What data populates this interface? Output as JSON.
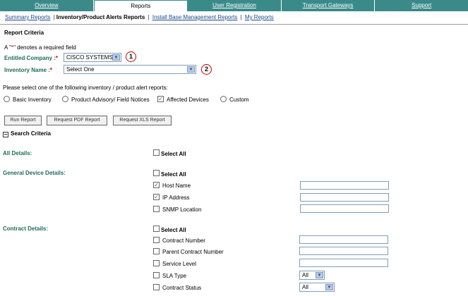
{
  "topnav": [
    {
      "label": "Overview",
      "active": false
    },
    {
      "label": "Reports",
      "active": true
    },
    {
      "label": "User Registration",
      "active": false
    },
    {
      "label": "Transport Gateways",
      "active": false
    },
    {
      "label": "Support",
      "active": false
    }
  ],
  "subnav": {
    "summary": "Summary Reports",
    "current": "Inventory/Product Alerts Reports",
    "install_base": "Install Base Management Reports",
    "my_reports": "My Reports"
  },
  "criteria": {
    "title": "Report Criteria",
    "required_note_prefix": "A \"",
    "required_star": "*",
    "required_note_suffix": "\" denotes a required field",
    "entitled_company_label": "Entitled Company :",
    "entitled_company_value": "CISCO SYSTEMS",
    "inventory_name_label": "Inventory Name :",
    "inventory_name_value": "Select One",
    "callout_1": "1",
    "callout_2": "2",
    "report_prompt": "Please select one of the following inventory / product alert reports:",
    "report_types": [
      "Basic Inventory",
      "Product Advisory/ Field Notices",
      "Affected Devices",
      "Custom"
    ]
  },
  "buttons": {
    "run": "Run Report",
    "pdf": "Request PDF Report",
    "xls": "Request XLS Report"
  },
  "search": {
    "title": "Search Criteria",
    "select_all": "Select All",
    "all_details": "All Details:",
    "general_details": "General Device Details:",
    "contract_details": "Contract Details:",
    "general_fields": [
      {
        "label": "Host Name",
        "checked": true
      },
      {
        "label": "IP Address",
        "checked": true
      },
      {
        "label": "SNMP Location",
        "checked": false
      }
    ],
    "contract_fields": [
      {
        "label": "Contract Number"
      },
      {
        "label": "Parent Contract Number"
      },
      {
        "label": "Service Level"
      },
      {
        "label": "SLA Type",
        "select": "All"
      },
      {
        "label": "Contract Status",
        "select": "All"
      }
    ]
  },
  "figure_id": "188396",
  "check_mark": "✓",
  "minus_sign": "−",
  "arrow_glyph": "▼"
}
